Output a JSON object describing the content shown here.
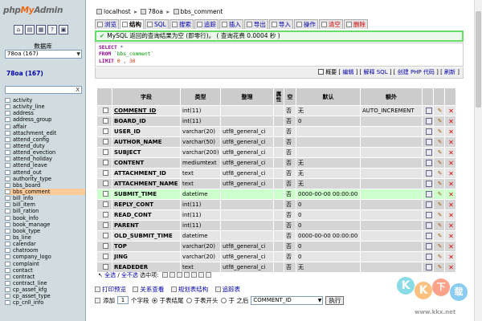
{
  "sidebar": {
    "logo_php": "php",
    "logo_my": "My",
    "logo_admin": "Admin",
    "toolbar_icons": [
      "home-icon",
      "sql-window-icon",
      "docs-icon",
      "help-icon",
      "query-window-icon"
    ],
    "database_label": "数据库",
    "database_select": "78oa (167)",
    "current_db": "78oa (167)",
    "filter_clear": "X",
    "tables": [
      "activity",
      "activity_line",
      "address",
      "address_group",
      "affair",
      "attachment_edit",
      "attend_config",
      "attend_duty",
      "attend_evection",
      "attend_holiday",
      "attend_leave",
      "attend_out",
      "authority_type",
      "bbs_board",
      "bbs_comment",
      "bill_info",
      "bill_item",
      "bill_ration",
      "book_info",
      "book_manage",
      "book_type",
      "bs_line",
      "calendar",
      "chatroom",
      "company_logo",
      "complaint",
      "contact",
      "contract",
      "contract_line",
      "cp_asset_kfg",
      "cp_asset_type",
      "cp_cnll_info"
    ],
    "selected_table_index": 14
  },
  "breadcrumb": {
    "server": "localhost",
    "database": "78oa",
    "table": "bbs_comment"
  },
  "tabs": [
    {
      "label": "浏览",
      "active": false,
      "warn": false
    },
    {
      "label": "结构",
      "active": true,
      "warn": false
    },
    {
      "label": "SQL",
      "active": false,
      "warn": false
    },
    {
      "label": "搜索",
      "active": false,
      "warn": false
    },
    {
      "label": "追踪",
      "active": false,
      "warn": false
    },
    {
      "label": "插入",
      "active": false,
      "warn": false
    },
    {
      "label": "导出",
      "active": false,
      "warn": false
    },
    {
      "label": "导入",
      "active": false,
      "warn": false
    },
    {
      "label": "操作",
      "active": false,
      "warn": false
    },
    {
      "label": "清空",
      "active": false,
      "warn": true
    },
    {
      "label": "删除",
      "active": false,
      "warn": true
    }
  ],
  "success_message": "MySQL 返回的查询结果为空 (即零行)。 ( 查询花费 0.0004 秒 )",
  "sql": {
    "line1_kw": "SELECT",
    "line1_rest": " *",
    "line2_kw": "FROM",
    "line2_rest": " `bbs_comment`",
    "line3_kw": "LIMIT",
    "line3_a": " 0",
    "line3_sep": " , ",
    "line3_b": "30"
  },
  "sql_links": {
    "profiling": "概要",
    "edit": "编辑",
    "explain": "解释 SQL",
    "create_php": "创建 PHP 代码",
    "refresh": "刷新"
  },
  "table_headers": {
    "field": "字段",
    "type": "类型",
    "collation": "整理",
    "attributes": "属性",
    "null": "空",
    "default": "默认",
    "extra": "额外"
  },
  "columns": [
    {
      "name": "COMMENT_ID",
      "type": "int(11)",
      "collation": "",
      "null": "否",
      "default": "无",
      "extra": "AUTO_INCREMENT",
      "primary": true
    },
    {
      "name": "BOARD_ID",
      "type": "int(11)",
      "collation": "",
      "null": "否",
      "default": "0",
      "extra": "",
      "primary": false
    },
    {
      "name": "USER_ID",
      "type": "varchar(20)",
      "collation": "utf8_general_ci",
      "null": "否",
      "default": "",
      "extra": "",
      "primary": false
    },
    {
      "name": "AUTHOR_NAME",
      "type": "varchar(50)",
      "collation": "utf8_general_ci",
      "null": "否",
      "default": "",
      "extra": "",
      "primary": false
    },
    {
      "name": "SUBJECT",
      "type": "varchar(200)",
      "collation": "utf8_general_ci",
      "null": "否",
      "default": "",
      "extra": "",
      "primary": false
    },
    {
      "name": "CONTENT",
      "type": "mediumtext",
      "collation": "utf8_general_ci",
      "null": "否",
      "default": "无",
      "extra": "",
      "primary": false
    },
    {
      "name": "ATTACHMENT_ID",
      "type": "text",
      "collation": "utf8_general_ci",
      "null": "否",
      "default": "无",
      "extra": "",
      "primary": false
    },
    {
      "name": "ATTACHMENT_NAME",
      "type": "text",
      "collation": "utf8_general_ci",
      "null": "否",
      "default": "无",
      "extra": "",
      "primary": false
    },
    {
      "name": "SUBMIT_TIME",
      "type": "datetime",
      "collation": "",
      "null": "否",
      "default": "0000-00-00 00:00:00",
      "extra": "",
      "primary": false,
      "highlight": true
    },
    {
      "name": "REPLY_CONT",
      "type": "int(11)",
      "collation": "",
      "null": "否",
      "default": "0",
      "extra": "",
      "primary": false
    },
    {
      "name": "READ_CONT",
      "type": "int(11)",
      "collation": "",
      "null": "否",
      "default": "0",
      "extra": "",
      "primary": false
    },
    {
      "name": "PARENT",
      "type": "int(11)",
      "collation": "",
      "null": "否",
      "default": "0",
      "extra": "",
      "primary": false
    },
    {
      "name": "OLD_SUBMIT_TIME",
      "type": "datetime",
      "collation": "",
      "null": "否",
      "default": "0000-00-00 00:00:00",
      "extra": "",
      "primary": false
    },
    {
      "name": "TOP",
      "type": "varchar(20)",
      "collation": "utf8_general_ci",
      "null": "否",
      "default": "0",
      "extra": "",
      "primary": false
    },
    {
      "name": "JING",
      "type": "varchar(20)",
      "collation": "utf8_general_ci",
      "null": "否",
      "default": "0",
      "extra": "",
      "primary": false
    },
    {
      "name": "READEDER",
      "type": "text",
      "collation": "utf8_general_ci",
      "null": "否",
      "default": "无",
      "extra": "",
      "primary": false
    }
  ],
  "selection_bar": {
    "select_all": "全选",
    "separator": " / ",
    "deselect_all": "全不选",
    "with_selected": "选中项:"
  },
  "links": {
    "print_view": "打印预览",
    "relation_view": "关系查看",
    "propose_structure": "规划表结构",
    "track_table": "追踪表"
  },
  "add_field": {
    "label": "添加",
    "count": "1",
    "unit": "个字段",
    "at_end": "于表结尾",
    "at_begin": "于表开头",
    "after": "于 之后",
    "after_field": "COMMENT_ID",
    "go_button": "执行"
  },
  "watermark": {
    "letters": [
      "K",
      "K",
      "下",
      "载"
    ],
    "url": "www.kkx.net"
  }
}
